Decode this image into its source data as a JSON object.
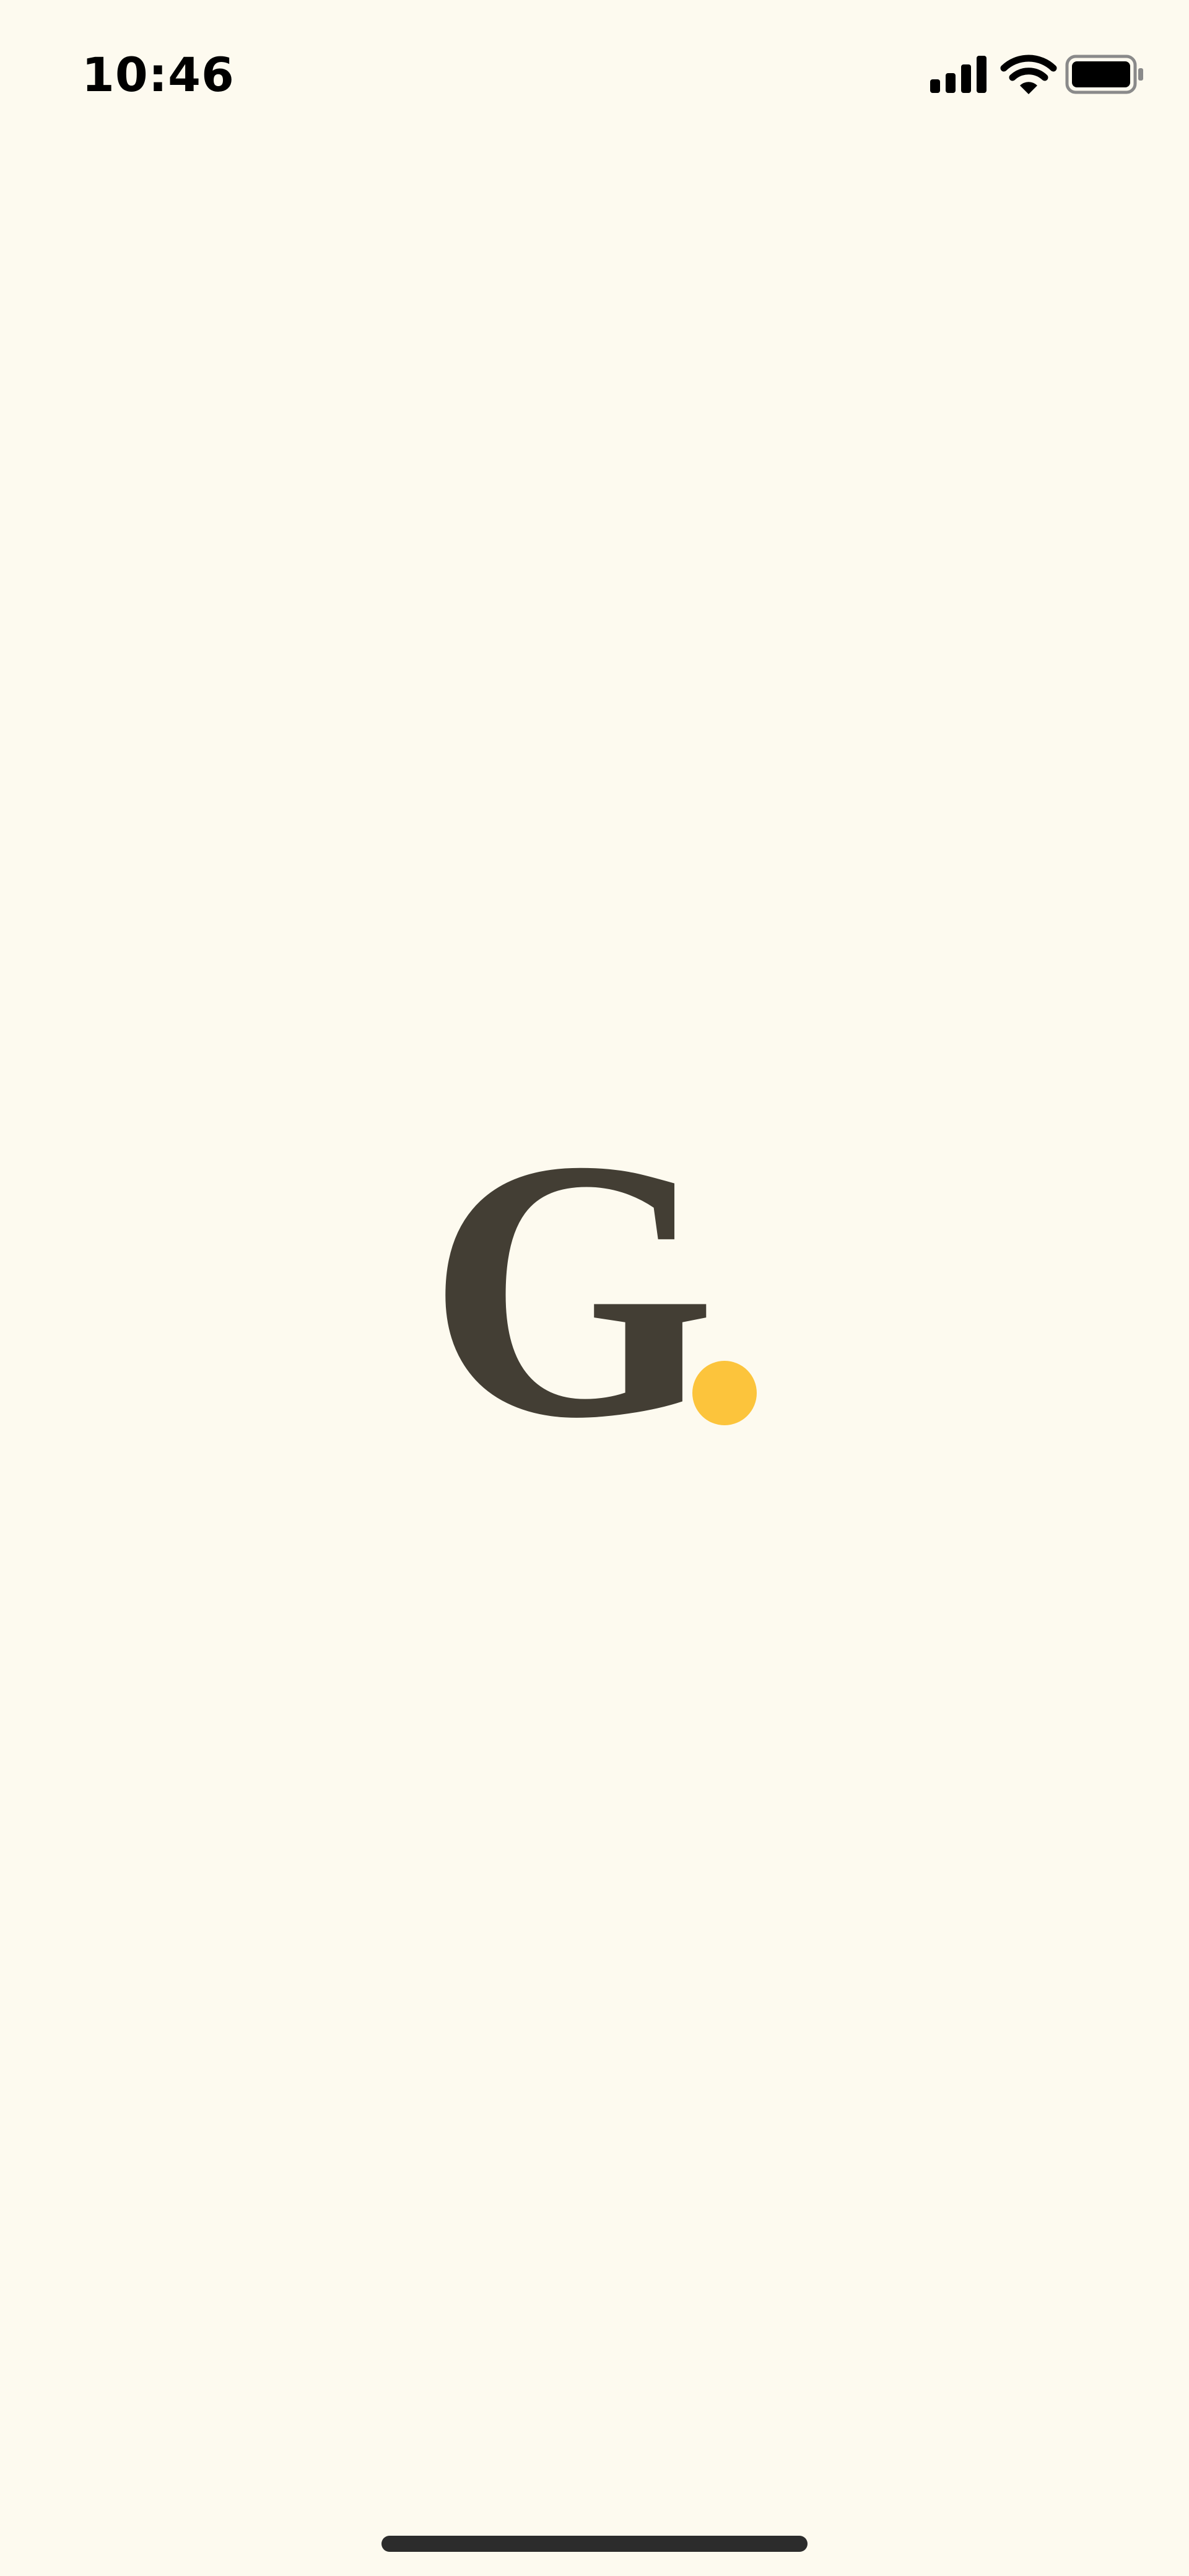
{
  "status_bar": {
    "time": "10:46",
    "icons": [
      "signal-icon",
      "wifi-icon",
      "battery-icon"
    ]
  },
  "splash": {
    "logo_letter": "G",
    "logo_dot": "."
  },
  "colors": {
    "background": "#FDFAEF",
    "logo_letter": "#433E34",
    "logo_dot": "#FCC43C",
    "status_text": "#000000",
    "home_indicator": "#2C2C2C"
  }
}
